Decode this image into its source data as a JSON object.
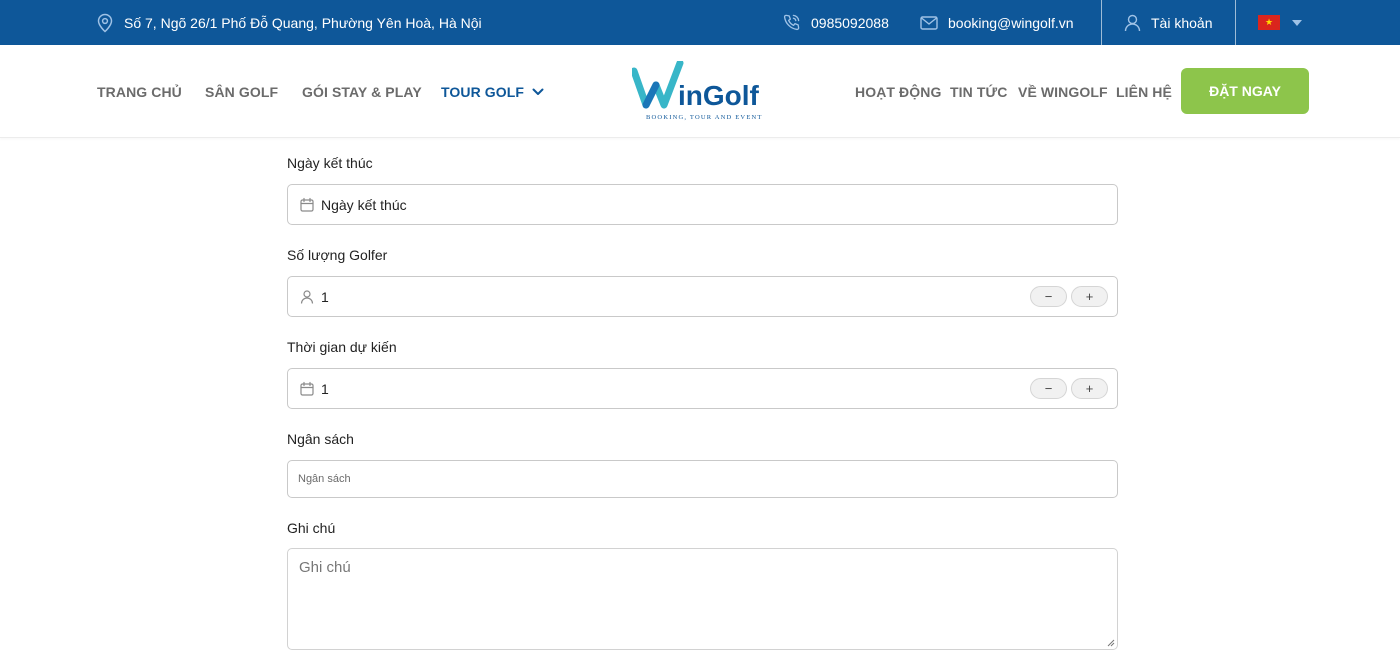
{
  "topbar": {
    "address": "Số 7, Ngõ 26/1 Phố Đỗ Quang, Phường Yên Hoà, Hà Nội",
    "phone": "0985092088",
    "email": "booking@wingolf.vn",
    "account": "Tài khoản",
    "language_flag": "vietnam-flag"
  },
  "nav": {
    "items": [
      "TRANG CHỦ",
      "SÂN GOLF",
      "GÓI STAY & PLAY",
      "TOUR GOLF",
      "HOẠT ĐỘNG",
      "TIN TỨC",
      "VỀ WINGOLF",
      "LIÊN HỆ"
    ],
    "active": "TOUR GOLF",
    "book_button": "ĐẶT NGAY"
  },
  "logo": {
    "name": "WinGolf",
    "tagline": "BOOKING, TOUR AND EVENT"
  },
  "form": {
    "end_date": {
      "label": "Ngày kết thúc",
      "placeholder": "Ngày kết thúc"
    },
    "golfers": {
      "label": "Số lượng Golfer",
      "value": "1",
      "minus": "−",
      "plus": "+"
    },
    "duration": {
      "label": "Thời gian dự kiến",
      "value": "1",
      "minus": "−",
      "plus": "+"
    },
    "budget": {
      "label": "Ngân sách",
      "placeholder": "Ngân sách"
    },
    "notes": {
      "label": "Ghi chú",
      "placeholder": "Ghi chú"
    }
  },
  "colors": {
    "topbar_bg": "#0e5799",
    "accent_green": "#8dc54b",
    "nav_active": "#0e5799",
    "nav_text": "#6b6b6b"
  }
}
